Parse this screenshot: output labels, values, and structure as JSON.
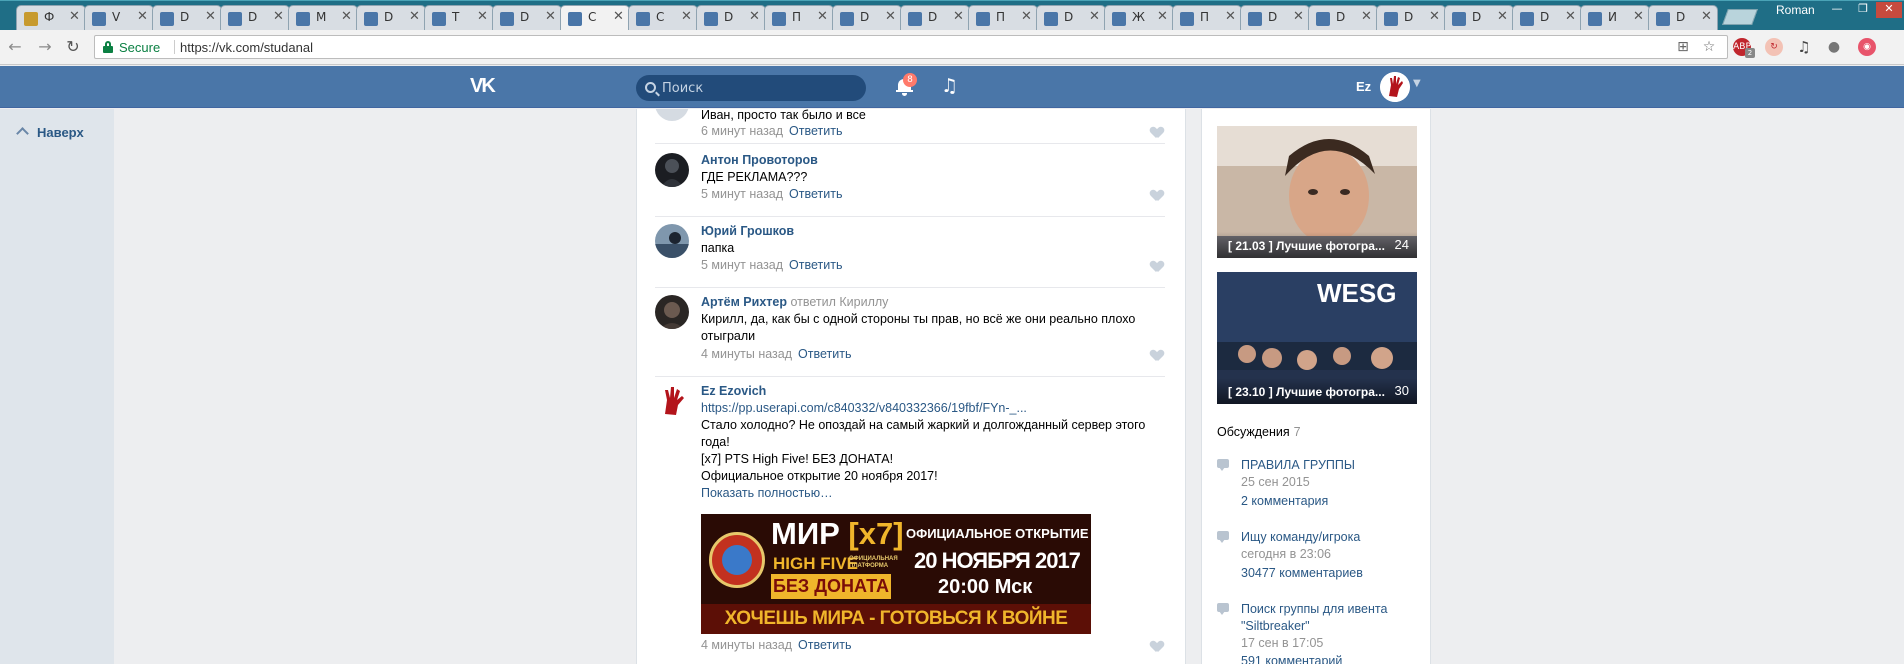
{
  "browser": {
    "tabs": [
      {
        "label": "Ф",
        "favicon_color": "#c79a2e"
      },
      {
        "label": "V",
        "favicon_color": "#4a76a8"
      },
      {
        "label": "D",
        "favicon_color": "#4a76a8"
      },
      {
        "label": "D",
        "favicon_color": "#4a76a8"
      },
      {
        "label": "M",
        "favicon_color": "#4a76a8"
      },
      {
        "label": "D",
        "favicon_color": "#4a76a8"
      },
      {
        "label": "T",
        "favicon_color": "#4a76a8"
      },
      {
        "label": "D",
        "favicon_color": "#4a76a8"
      },
      {
        "label": "C",
        "favicon_color": "#4a76a8",
        "active": true
      },
      {
        "label": "C",
        "favicon_color": "#4a76a8"
      },
      {
        "label": "D",
        "favicon_color": "#4a76a8"
      },
      {
        "label": "П",
        "favicon_color": "#4a76a8"
      },
      {
        "label": "D",
        "favicon_color": "#4a76a8"
      },
      {
        "label": "D",
        "favicon_color": "#4a76a8"
      },
      {
        "label": "П",
        "favicon_color": "#4a76a8"
      },
      {
        "label": "D",
        "favicon_color": "#4a76a8"
      },
      {
        "label": "Ж",
        "favicon_color": "#4a76a8"
      },
      {
        "label": "П",
        "favicon_color": "#4a76a8"
      },
      {
        "label": "D",
        "favicon_color": "#4a76a8"
      },
      {
        "label": "D",
        "favicon_color": "#4a76a8"
      },
      {
        "label": "D",
        "favicon_color": "#4a76a8"
      },
      {
        "label": "D",
        "favicon_color": "#4a76a8"
      },
      {
        "label": "D",
        "favicon_color": "#4a76a8"
      },
      {
        "label": "И",
        "favicon_color": "#4a76a8"
      },
      {
        "label": "D",
        "favicon_color": "#4a76a8"
      }
    ],
    "tab_close_glyph": "✕",
    "profile_name": "Roman",
    "window_controls": {
      "minimize": "—",
      "restore": "❐",
      "close": "✕"
    },
    "nav": {
      "back": "←",
      "forward": "→",
      "reload": "↻"
    },
    "security_label": "Secure",
    "url": "https://vk.com/studanal",
    "extension_badge": "2",
    "icons": [
      "translate-icon",
      "star-icon",
      "adblock-icon",
      "extension-icon",
      "music-extension-icon",
      "eyedropper-icon",
      "color-picker-icon"
    ]
  },
  "vk": {
    "logo": "VK",
    "search_placeholder": "Поиск",
    "notifications_count": "8",
    "user_initials": "Ez",
    "brand_color": "#4a76a8"
  },
  "left_rail": {
    "to_top_label": "Наверх"
  },
  "comments": [
    {
      "author": "",
      "text": "Иван, просто так было и все",
      "time": "6 минут назад",
      "reply_label": "Ответить"
    },
    {
      "author": "Антон Провоторов",
      "text": "ГДЕ РЕКЛАМА???",
      "time": "5 минут назад",
      "reply_label": "Ответить"
    },
    {
      "author": "Юрий Грошков",
      "text": "папка",
      "time": "5 минут назад",
      "reply_label": "Ответить"
    },
    {
      "author": "Артём Рихтер",
      "replied_to": "ответил Кириллу",
      "text": "Кирилл, да, как бы с одной стороны ты прав, но всё же они реально плохо отыграли",
      "time": "4 минуты назад",
      "reply_label": "Ответить"
    },
    {
      "author": "Ez Ezovich",
      "link": "https://pp.userapi.com/c840332/v840332366/19fbf/FYn-_...",
      "text_lines": [
        "Стало холодно? Не опоздай на самый жаркий и долгожданный сервер этого года!",
        "[x7] PTS High Five! БЕЗ ДОНАТА!",
        "Официальное открытие 20 ноября 2017!"
      ],
      "show_more": "Показать полностью…",
      "time": "4 минуты назад",
      "reply_label": "Ответить"
    }
  ],
  "banner": {
    "title": "МИР",
    "title_tag": "[x7]",
    "official": "ОФИЦИАЛЬНОЕ ОТКРЫТИЕ",
    "high_five": "HIGH FIVE",
    "platform": "ОФИЦИАЛЬНАЯ ПЛАТФОРМА",
    "date": "20 НОЯБРЯ 2017",
    "no_donate": "БЕЗ ДОНАТА",
    "time": "20:00 Мск",
    "slogan": "ХОЧЕШЬ МИРА - ГОТОВЬСЯ К ВОЙНЕ"
  },
  "albums": [
    {
      "title": "[ 21.03 ] Лучшие фотогра...",
      "count": "24"
    },
    {
      "title": "[ 23.10 ] Лучшие фотогра...",
      "count": "30"
    }
  ],
  "discussions": {
    "heading": "Обсуждения",
    "count": "7",
    "topics": [
      {
        "title": "ПРАВИЛА ГРУППЫ",
        "date": "25 сен 2015",
        "comments": "2 комментария"
      },
      {
        "title": "Ищу команду/игрока",
        "date": "сегодня в 23:06",
        "comments": "30477 комментариев"
      },
      {
        "title": "Поиск группы для ивента \"Siltbreaker\"",
        "date": "17 сен в 17:05",
        "comments": "591 комментарий"
      }
    ]
  }
}
